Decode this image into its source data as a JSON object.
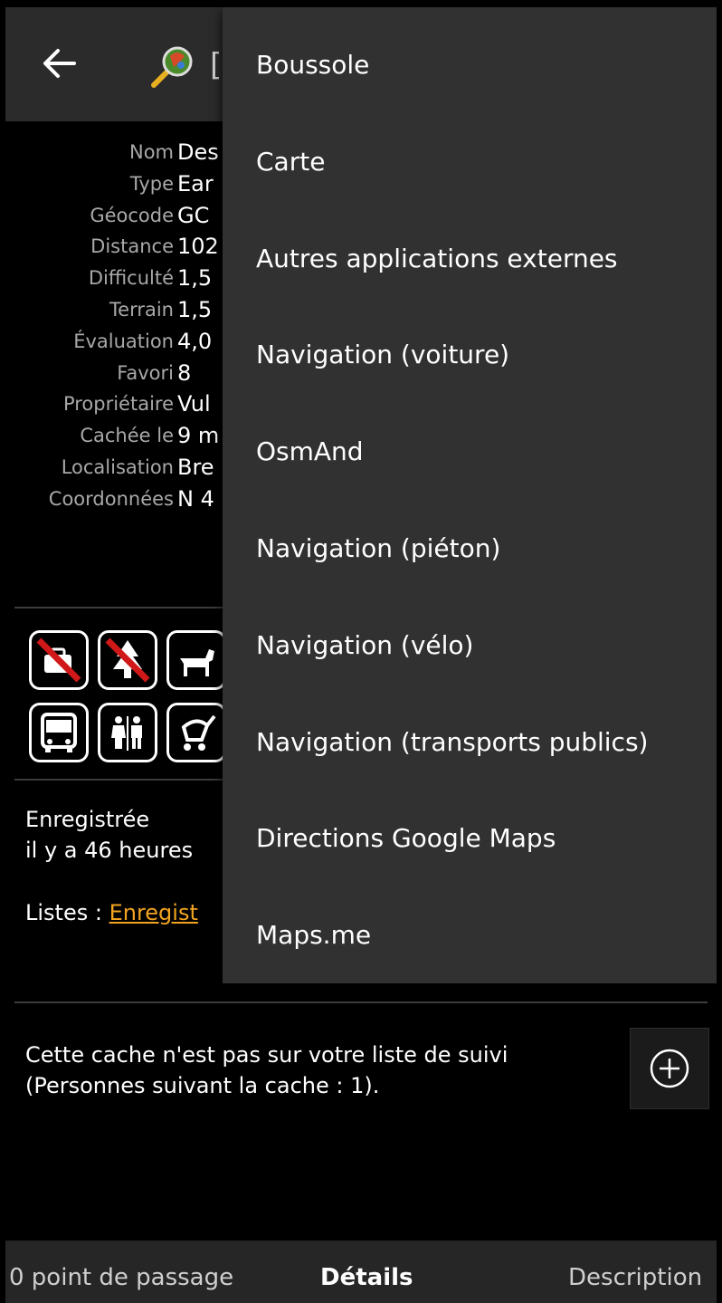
{
  "appbar": {
    "title_peek": "["
  },
  "details": [
    {
      "label": "Nom",
      "value": "Des"
    },
    {
      "label": "Type",
      "value": "Ear"
    },
    {
      "label": "Géocode",
      "value": "GC"
    },
    {
      "label": "Distance",
      "value": "102"
    },
    {
      "label": "Difficulté",
      "value": "1,5"
    },
    {
      "label": "Terrain",
      "value": "1,5"
    },
    {
      "label": "Évaluation",
      "value": "4,0"
    },
    {
      "label": "Favori",
      "value": "8"
    },
    {
      "label": "Propriétaire",
      "value": "Vul"
    },
    {
      "label": "Cachée le",
      "value": "9 m"
    },
    {
      "label": "Localisation",
      "value": "Bre"
    },
    {
      "label": "Coordonnées",
      "value": "N 4"
    }
  ],
  "attributes": [
    "no-luggage-icon",
    "no-forest-icon",
    "dog-icon",
    "bus-icon",
    "restroom-icon",
    "stroller-icon"
  ],
  "saved": {
    "line1": "Enregistrée",
    "line2": "il y a 46 heures"
  },
  "lists": {
    "label": "Listes :",
    "link": "Enregist"
  },
  "watch": {
    "line1": "Cette cache n'est pas sur votre liste de suivi",
    "line2": "(Personnes suivant la cache : 1)."
  },
  "tabs": {
    "left": "0 point de passage",
    "center": "Détails",
    "right": "Description"
  },
  "menu": [
    "Boussole",
    "Carte",
    "Autres applications externes",
    "Navigation (voiture)",
    "OsmAnd",
    "Navigation (piéton)",
    "Navigation (vélo)",
    "Navigation (transports publics)",
    "Directions Google Maps",
    "Maps.me"
  ],
  "colors": {
    "appbar": "#2b2b2b",
    "menu": "#313131",
    "link": "#f2a421",
    "label": "#a8a8a8"
  }
}
